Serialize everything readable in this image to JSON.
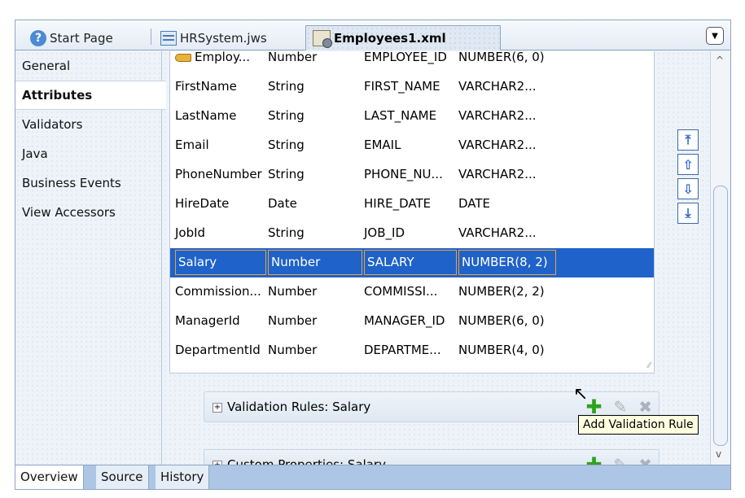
{
  "tabs": [
    {
      "label": "Start Page",
      "icon": "help-icon"
    },
    {
      "label": "HRSystem.jws",
      "icon": "workspace-file-icon"
    },
    {
      "label": "Employees1.xml",
      "icon": "xml-file-icon",
      "active": true
    }
  ],
  "sidebar": {
    "items": [
      {
        "label": "General"
      },
      {
        "label": "Attributes",
        "selected": true
      },
      {
        "label": "Validators"
      },
      {
        "label": "Java"
      },
      {
        "label": "Business Events"
      },
      {
        "label": "View Accessors"
      }
    ]
  },
  "attributes": {
    "rows": [
      {
        "name": "Employ...",
        "type": "Number",
        "column": "EMPLOYEE_ID",
        "sqltype": "NUMBER(6, 0)",
        "key": true
      },
      {
        "name": "FirstName",
        "type": "String",
        "column": "FIRST_NAME",
        "sqltype": "VARCHAR2..."
      },
      {
        "name": "LastName",
        "type": "String",
        "column": "LAST_NAME",
        "sqltype": "VARCHAR2..."
      },
      {
        "name": "Email",
        "type": "String",
        "column": "EMAIL",
        "sqltype": "VARCHAR2..."
      },
      {
        "name": "PhoneNumber",
        "type": "String",
        "column": "PHONE_NU...",
        "sqltype": "VARCHAR2..."
      },
      {
        "name": "HireDate",
        "type": "Date",
        "column": "HIRE_DATE",
        "sqltype": "DATE"
      },
      {
        "name": "JobId",
        "type": "String",
        "column": "JOB_ID",
        "sqltype": "VARCHAR2..."
      },
      {
        "name": "Salary",
        "type": "Number",
        "column": "SALARY",
        "sqltype": "NUMBER(8, 2)",
        "selected": true
      },
      {
        "name": "Commission...",
        "type": "Number",
        "column": "COMMISSI...",
        "sqltype": "NUMBER(2, 2)"
      },
      {
        "name": "ManagerId",
        "type": "Number",
        "column": "MANAGER_ID",
        "sqltype": "NUMBER(6, 0)"
      },
      {
        "name": "DepartmentId",
        "type": "Number",
        "column": "DEPARTME...",
        "sqltype": "NUMBER(4, 0)"
      }
    ]
  },
  "move_buttons": [
    "move-to-top-icon",
    "move-up-icon",
    "move-down-icon",
    "move-to-bottom-icon"
  ],
  "panels": {
    "validation": {
      "label": "Validation Rules: Salary",
      "expand": "+"
    },
    "custom": {
      "label": "Custom Properties: Salary",
      "expand": "+"
    }
  },
  "tooltip": {
    "text": "Add Validation Rule"
  },
  "bottom_tabs": [
    {
      "label": "Overview",
      "selected": true
    },
    {
      "label": "Source"
    },
    {
      "label": "History"
    }
  ],
  "glyphs": {
    "plus": "✚",
    "pencil": "✎",
    "x": "✖",
    "dropdown": "▼",
    "up": "⇧",
    "down": "⇩",
    "top": "⤒",
    "bottom": "⤓",
    "grip": "⁄⁄",
    "scroll_up": "^",
    "scroll_down": "v",
    "help": "?",
    "cursor": "↖"
  },
  "colors": {
    "selection": "#1f62c9",
    "accent_green": "#2fa21f",
    "tooltip_bg": "#ffffe1"
  }
}
